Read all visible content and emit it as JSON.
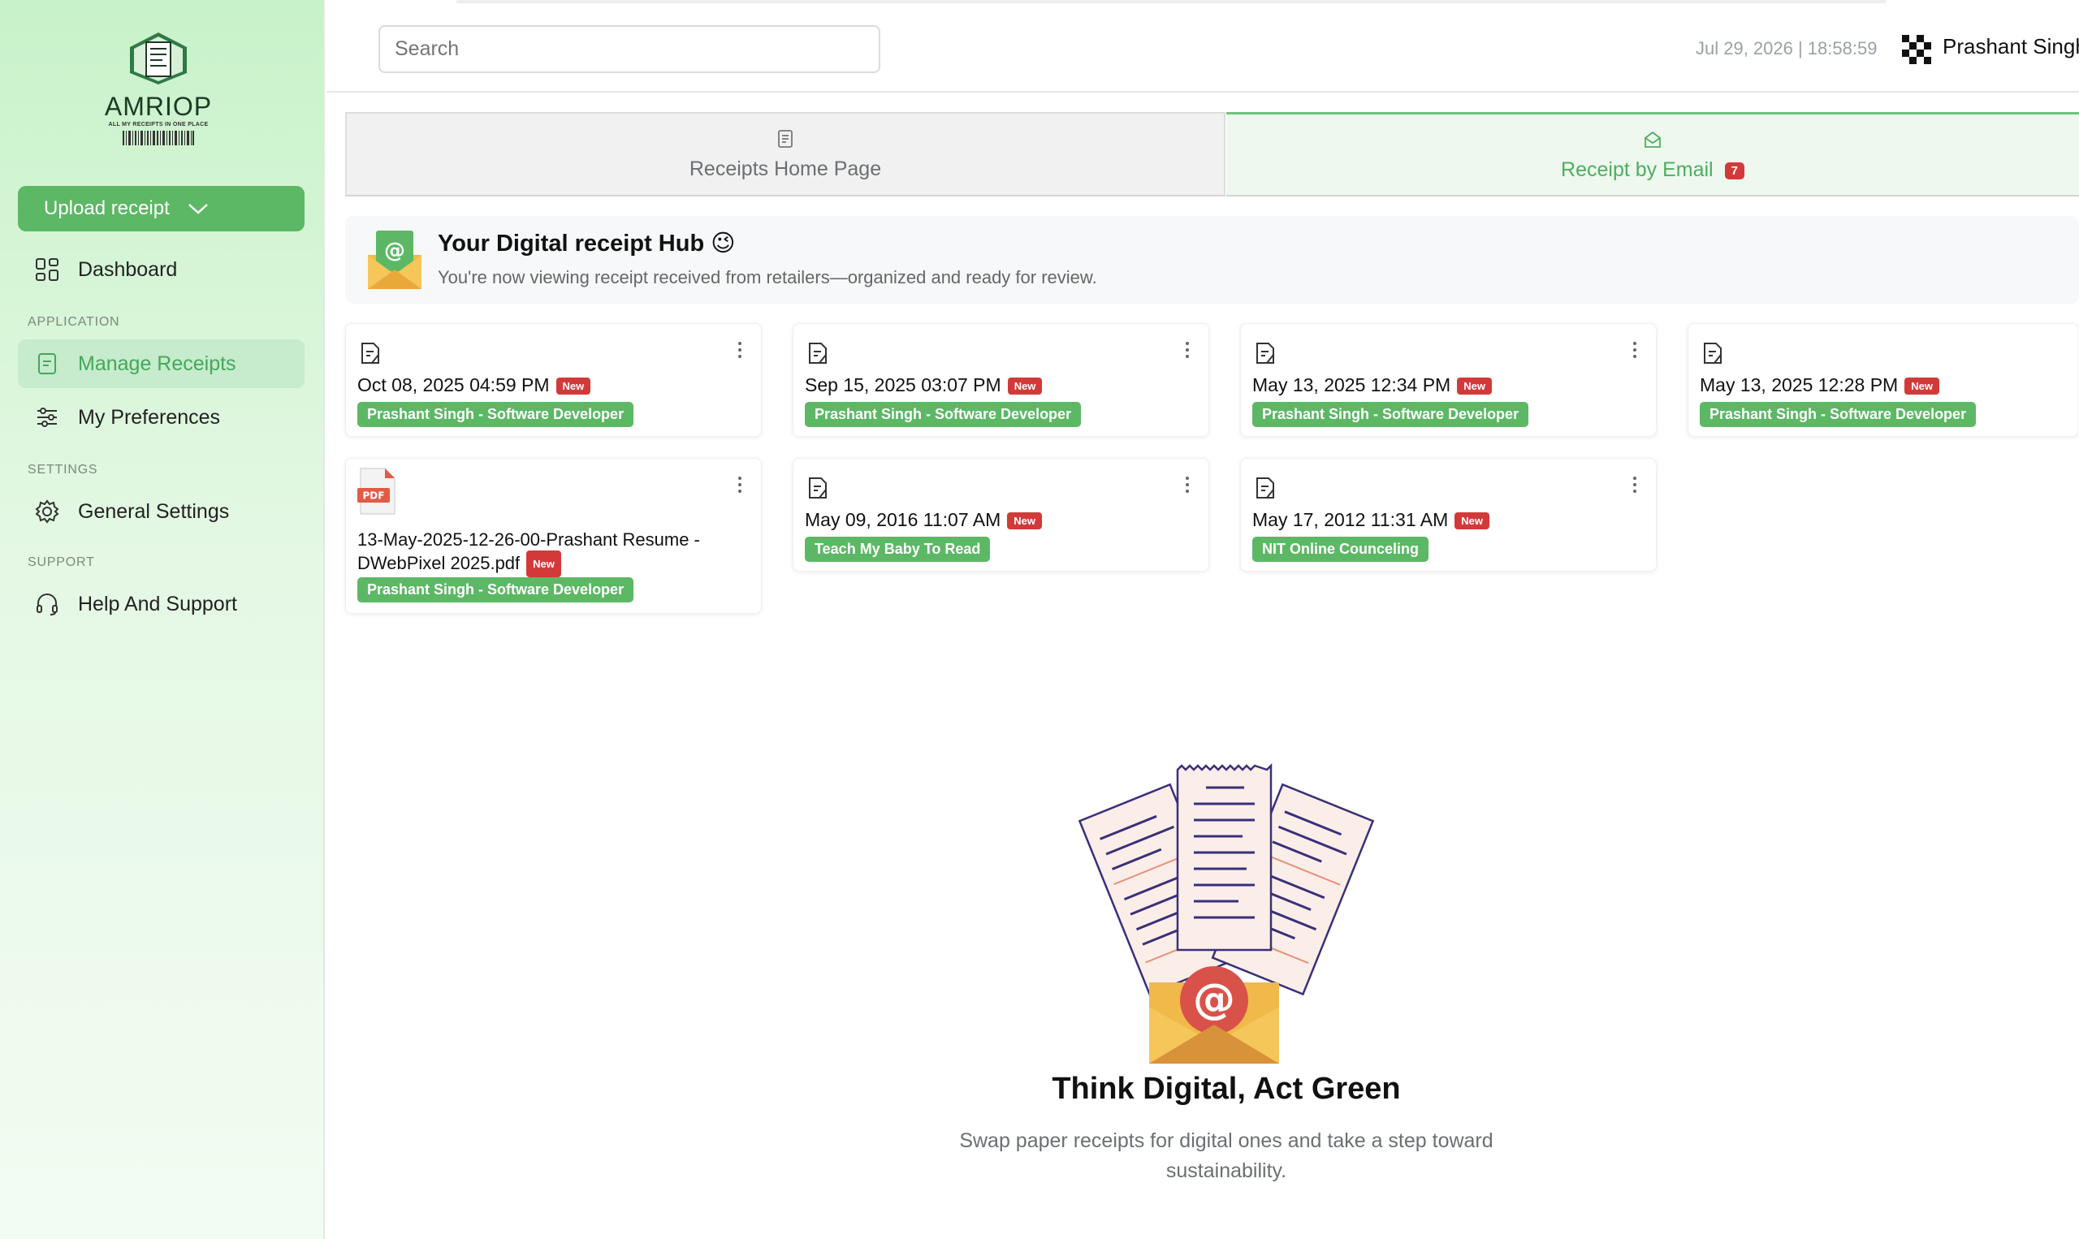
{
  "app": {
    "logo_title": "AMRIOP",
    "logo_tagline": "ALL MY RECEIPTS IN ONE PLACE"
  },
  "sidebar": {
    "upload_label": "Upload receipt",
    "dashboard_label": "Dashboard",
    "section_application": "APPLICATION",
    "manage_receipts_label": "Manage Receipts",
    "my_preferences_label": "My Preferences",
    "section_settings": "SETTINGS",
    "general_settings_label": "General Settings",
    "section_support": "SUPPORT",
    "help_support_label": "Help And Support"
  },
  "header": {
    "search_placeholder": "Search",
    "datetime": "Jul 29, 2026 | 18:58:59",
    "user_name": "Prashant Singh"
  },
  "tabs": {
    "home_label": "Receipts Home Page",
    "email_label": "Receipt by Email",
    "email_count": "7"
  },
  "hub": {
    "title": "Your Digital receipt Hub 😉",
    "description": "You're now viewing receipt received from retailers—organized and ready for review."
  },
  "receipts": [
    {
      "date": "Oct 08, 2025 04:59 PM",
      "badge": "New",
      "tag": "Prashant Singh - Software Developer"
    },
    {
      "date": "Sep 15, 2025 03:07 PM",
      "badge": "New",
      "tag": "Prashant Singh - Software Developer"
    },
    {
      "date": "May 13, 2025 12:34 PM",
      "badge": "New",
      "tag": "Prashant Singh - Software Developer"
    },
    {
      "date": "May 13, 2025 12:28 PM",
      "badge": "New",
      "tag": "Prashant Singh - Software Developer"
    },
    {
      "filename": "13-May-2025-12-26-00-Prashant Resume - DWebPixel 2025.pdf",
      "badge": "New",
      "tag": "Prashant Singh - Software Developer",
      "file_type": "PDF"
    },
    {
      "date": "May 09, 2016 11:07 AM",
      "badge": "New",
      "tag": "Teach My Baby To Read"
    },
    {
      "date": "May 17, 2012 11:31 AM",
      "badge": "New",
      "tag": "NIT Online Counceling"
    }
  ],
  "footer": {
    "title": "Think Digital, Act Green",
    "description": "Swap paper receipts for digital ones and take a step toward sustainability."
  },
  "colors": {
    "accent_green": "#5cb865",
    "badge_red": "#d23a3a",
    "sidebar_top": "#c8f2c9"
  },
  "icons": {
    "dashboard": "grid-icon",
    "manage_receipts": "receipt-icon",
    "preferences": "sliders-icon",
    "settings": "gear-icon",
    "support": "headset-icon",
    "card": "document-icon",
    "menu": "kebab-icon"
  }
}
